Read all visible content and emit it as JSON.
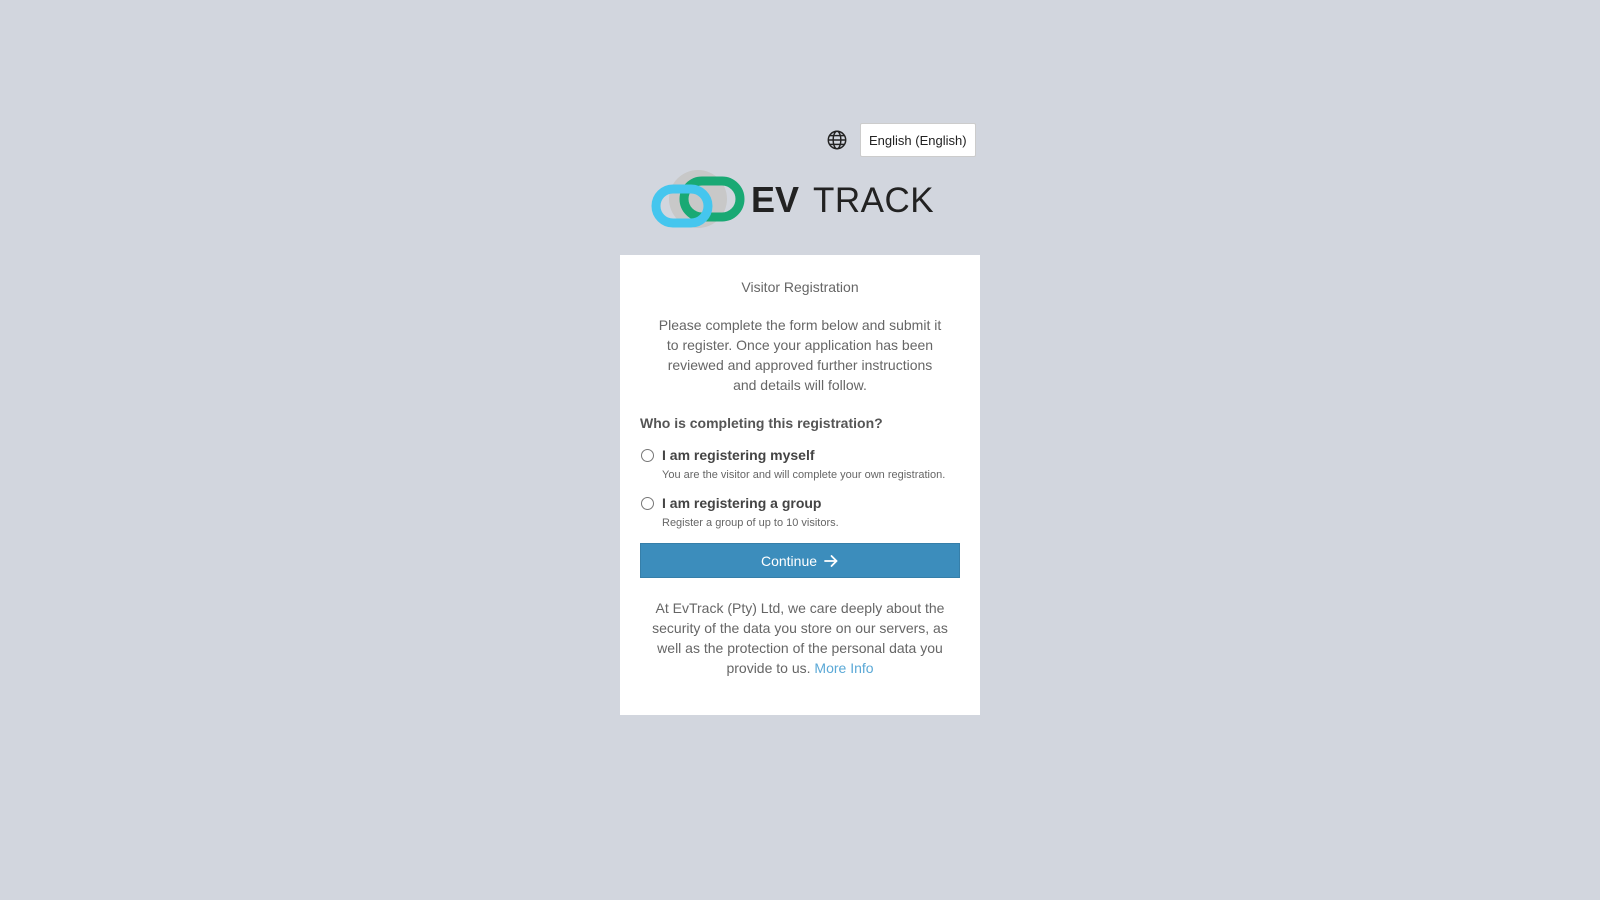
{
  "language": {
    "icon": "globe-icon",
    "selected": "English (English)"
  },
  "logo": {
    "text_bold": "EV",
    "text_light": "TRACK",
    "colors": {
      "green": "#19a974",
      "cyan": "#45c6ee",
      "gray": "#c8c8c8",
      "dark": "#222222"
    }
  },
  "form": {
    "title": "Visitor Registration",
    "intro": "Please complete the form below and submit it to register. Once your application has been reviewed and approved further instructions and details will follow.",
    "question": "Who is completing this registration?",
    "options": [
      {
        "label": "I am registering myself",
        "description": "You are the visitor and will complete your own registration."
      },
      {
        "label": "I am registering a group",
        "description": "Register a group of up to 10 visitors."
      }
    ],
    "continue_label": "Continue",
    "continue_icon": "arrow-right-icon",
    "privacy_text": "At EvTrack (Pty) Ltd, we care deeply about the security of the data you store on our servers, as well as the protection of the personal data you provide to us.",
    "more_info_label": "More Info"
  },
  "colors": {
    "background": "#d2d6de",
    "primary": "#3c8dbc",
    "link": "#5aa8d6"
  }
}
